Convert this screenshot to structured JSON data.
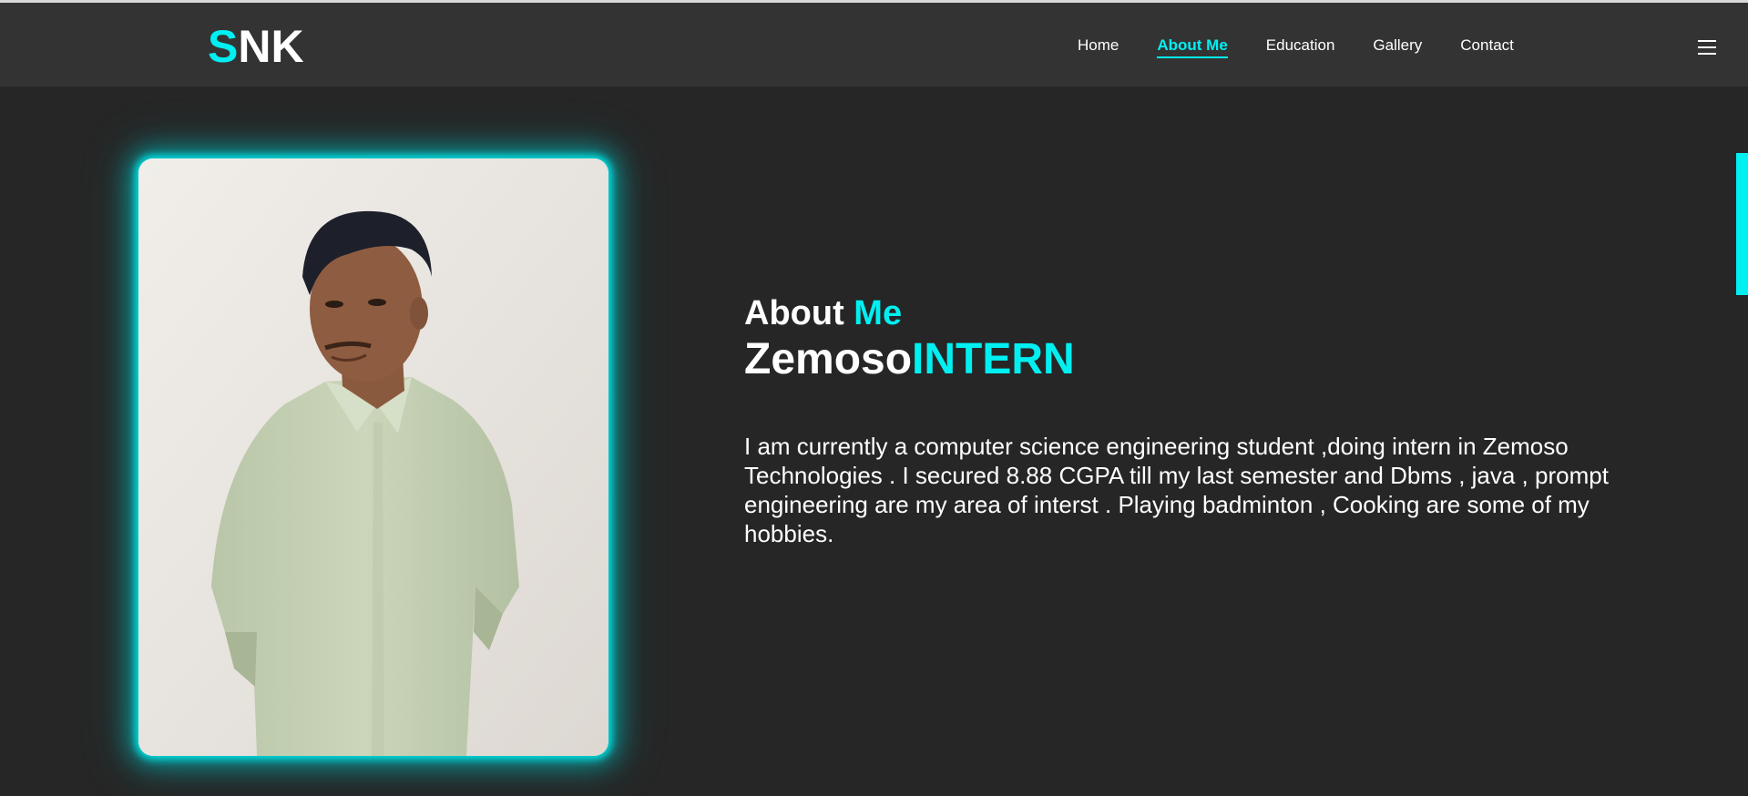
{
  "logo": {
    "first_letter": "S",
    "rest": "NK"
  },
  "nav": {
    "items": [
      {
        "label": "Home"
      },
      {
        "label": "About Me"
      },
      {
        "label": "Education"
      },
      {
        "label": "Gallery"
      },
      {
        "label": "Contact"
      }
    ],
    "active": "About Me"
  },
  "menu_icon": "hamburger-icon",
  "about": {
    "heading_prefix": "About ",
    "heading_accent": "Me",
    "role_prefix": "Zemoso",
    "role_accent": "INTERN",
    "bio": "I am currently a computer science engineering student ,doing intern in Zemoso Technologies . I secured 8.88 CGPA till my last semester and Dbms , java , prompt engineering are my area of interst . Playing badminton , Cooking are some of my hobbies."
  },
  "colors": {
    "accent": "#00f0f2",
    "background": "#262626",
    "header": "#333333",
    "text": "#ffffff"
  }
}
